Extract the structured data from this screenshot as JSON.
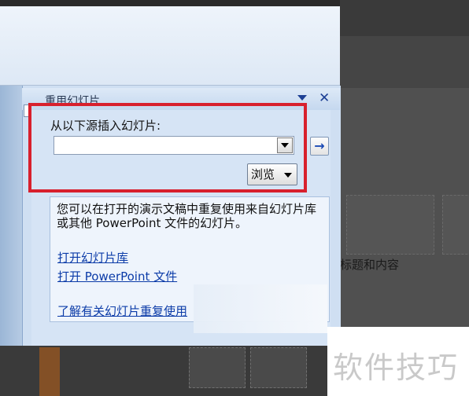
{
  "task_pane": {
    "title": "重用幻灯片",
    "source_label": "从以下源插入幻灯片:",
    "source_input_value": "",
    "browse_label": "浏览",
    "info_text": "您可以在打开的演示文稿中重复使用来自幻灯片库或其他 PowerPoint 文件的幻灯片。",
    "links": {
      "open_library": "打开幻灯片库",
      "open_powerpoint": "打开 PowerPoint 文件",
      "learn_more": "了解有关幻灯片重复使用"
    }
  },
  "background_app": {
    "layout_label": "标题和内容"
  },
  "watermark": "软件技巧",
  "colors": {
    "highlight": "#d8202d",
    "link": "#0b3ba8",
    "pane_bg": "#cfdff2"
  }
}
